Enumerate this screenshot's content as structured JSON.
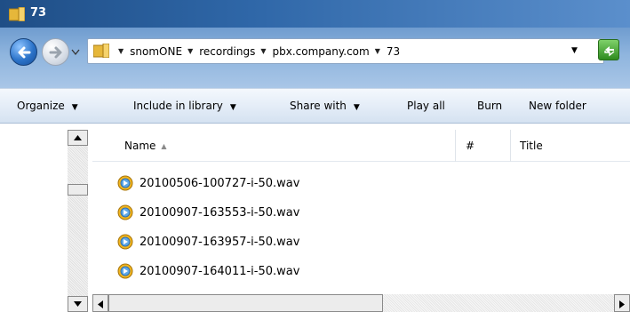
{
  "window": {
    "title": "73"
  },
  "address": {
    "crumbs": [
      "snomONE",
      "recordings",
      "pbx.company.com",
      "73"
    ]
  },
  "toolbar": {
    "organize": "Organize",
    "include_in_library": "Include in library",
    "share_with": "Share with",
    "play_all": "Play all",
    "burn": "Burn",
    "new_folder": "New folder"
  },
  "columns": {
    "name": "Name",
    "number": "#",
    "title": "Title"
  },
  "files": [
    {
      "name": "20100506-100727-i-50.wav"
    },
    {
      "name": "20100907-163553-i-50.wav"
    },
    {
      "name": "20100907-163957-i-50.wav"
    },
    {
      "name": "20100907-164011-i-50.wav"
    }
  ],
  "colors": {
    "titlebar": "#2f67a8",
    "addressbar_bg": "#8fb5de",
    "commandbar_bg": "#e3ecf7"
  }
}
